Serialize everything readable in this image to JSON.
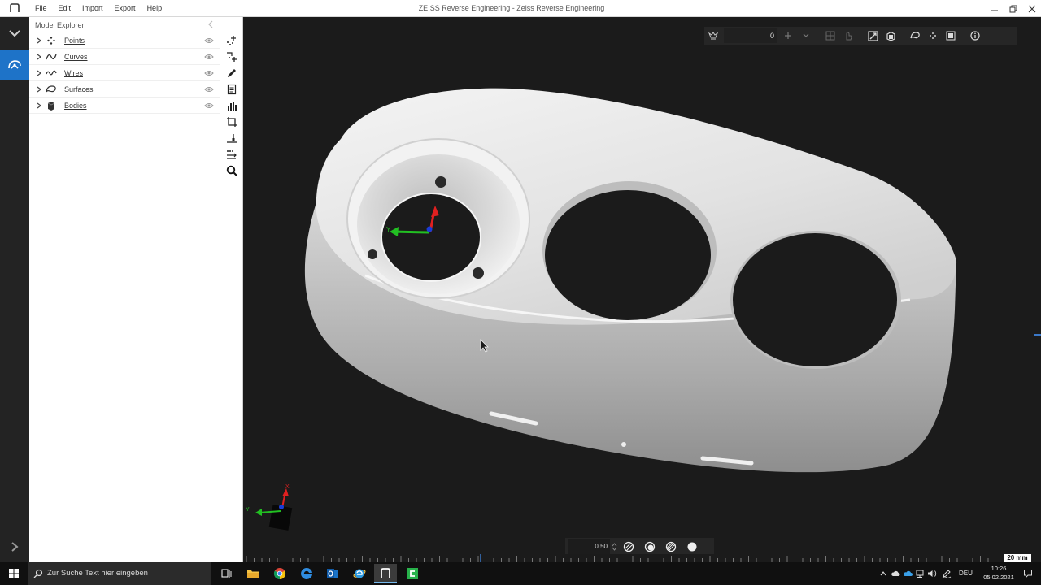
{
  "window": {
    "title": "ZEISS Reverse Engineering - Zeiss Reverse Engineering",
    "menu": [
      {
        "label": "File"
      },
      {
        "label": "Edit"
      },
      {
        "label": "Import"
      },
      {
        "label": "Export"
      },
      {
        "label": "Help"
      }
    ]
  },
  "rail": {
    "items": [
      {
        "icon": "chevron-down-icon"
      },
      {
        "icon": "reverse-engineering-icon",
        "active": true
      }
    ],
    "expand_icon": "chevron-right-icon"
  },
  "explorer": {
    "title": "Model Explorer",
    "items": [
      {
        "label": "Points",
        "icon": "points-icon"
      },
      {
        "label": "Curves",
        "icon": "curve-icon"
      },
      {
        "label": "Wires",
        "icon": "wire-icon"
      },
      {
        "label": "Surfaces",
        "icon": "surface-icon"
      },
      {
        "label": "Bodies",
        "icon": "body-icon"
      }
    ]
  },
  "toolstrip": {
    "tools": [
      {
        "icon": "add-points-icon"
      },
      {
        "icon": "edit-points-icon"
      },
      {
        "icon": "pen-icon"
      },
      {
        "icon": "report-icon"
      },
      {
        "icon": "bar-chart-icon"
      },
      {
        "icon": "crop-icon"
      },
      {
        "icon": "align-icon"
      },
      {
        "icon": "transform-icon"
      },
      {
        "icon": "search-icon"
      }
    ]
  },
  "viewport": {
    "top_toolbar": {
      "value": "0"
    },
    "bottom_toolbar": {
      "opacity_value": "0.50"
    },
    "axis_labels": {
      "x": "X",
      "y": "Y"
    },
    "scale_label": "20 mm"
  },
  "taskbar": {
    "search_placeholder": "Zur Suche Text hier eingeben",
    "language": "DEU",
    "time": "10:26",
    "date": "05.02.2021"
  },
  "colors": {
    "accent": "#1e73c8",
    "viewport_bg": "#1b1b1b",
    "axis_x": "#e02020",
    "axis_y": "#22c022",
    "axis_z": "#1a3cd8"
  }
}
